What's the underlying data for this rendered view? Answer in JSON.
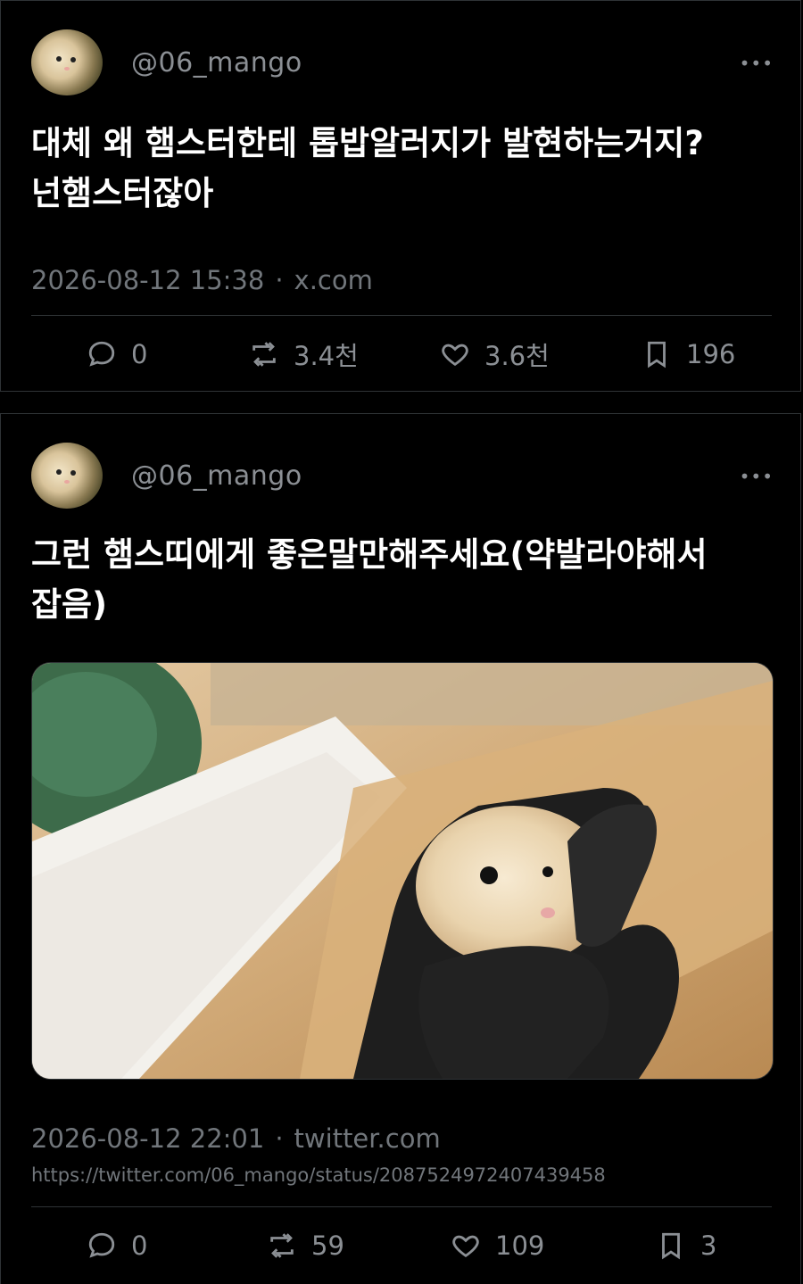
{
  "posts": [
    {
      "handle": "@06_mango",
      "more": "•••",
      "text": "대체 왜 햄스터한테 톱밥알러지가 발현하는거지? 넌햄스터잖아",
      "timestamp": "2026-08-12 15:38",
      "source": "x.com",
      "replies": "0",
      "reposts": "3.4천",
      "likes": "3.6천",
      "bookmarks": "196"
    },
    {
      "handle": "@06_mango",
      "more": "•••",
      "text": "그런 햄스띠에게 좋은말만해주세요(약발라야해서 잡음)",
      "timestamp": "2026-08-12 22:01",
      "source": "twitter.com",
      "link": "https://twitter.com/06_mango/status/2087524972407439458",
      "replies": "0",
      "reposts": "59",
      "likes": "109",
      "bookmarks": "3"
    }
  ]
}
